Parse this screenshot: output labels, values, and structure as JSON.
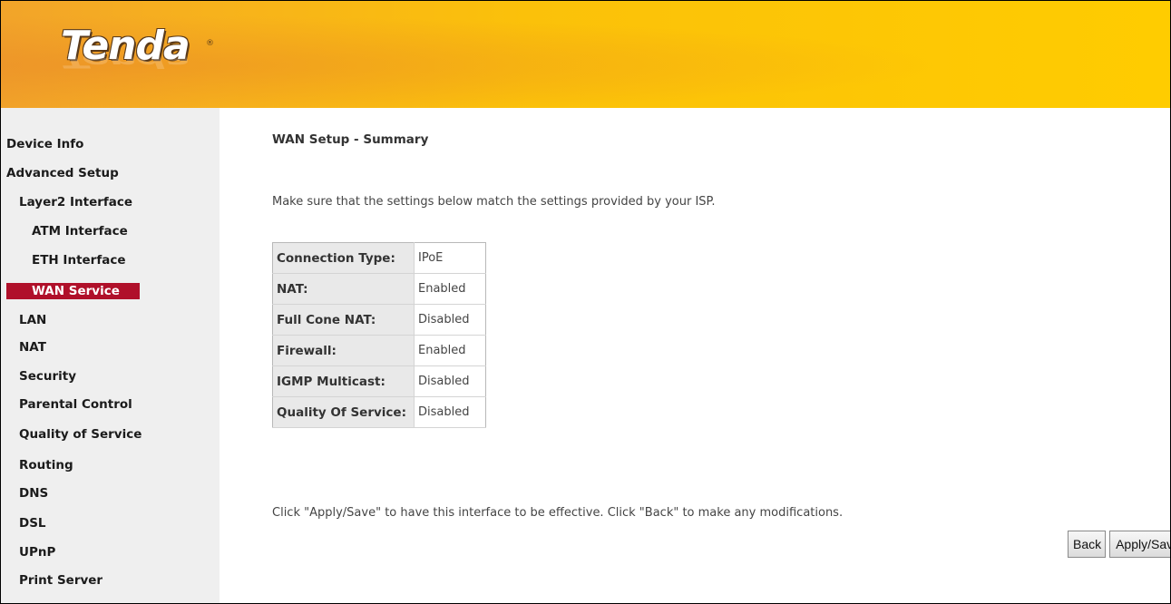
{
  "brand": {
    "logo_text": "Tenda",
    "registered_mark": "®"
  },
  "sidebar": {
    "items": [
      {
        "label": "Device Info",
        "level": 0
      },
      {
        "label": "Advanced Setup",
        "level": 0
      },
      {
        "label": "Layer2 Interface",
        "level": 1
      },
      {
        "label": "ATM Interface",
        "level": 2
      },
      {
        "label": "ETH Interface",
        "level": 2
      },
      {
        "label": "WAN Service",
        "level": 2,
        "active": true
      },
      {
        "label": "LAN",
        "level": 1
      },
      {
        "label": "NAT",
        "level": 1
      },
      {
        "label": "Security",
        "level": 1
      },
      {
        "label": "Parental Control",
        "level": 1
      },
      {
        "label": "Quality of Service",
        "level": 1
      },
      {
        "label": "Routing",
        "level": 1
      },
      {
        "label": "DNS",
        "level": 1
      },
      {
        "label": "DSL",
        "level": 1
      },
      {
        "label": "UPnP",
        "level": 1
      },
      {
        "label": "Print Server",
        "level": 1
      }
    ]
  },
  "main": {
    "title": "WAN Setup - Summary",
    "intro": "Make sure that the settings below match the settings provided by your ISP.",
    "summary_rows": [
      {
        "label": "Connection Type:",
        "value": "IPoE"
      },
      {
        "label": "NAT:",
        "value": "Enabled"
      },
      {
        "label": "Full Cone NAT:",
        "value": "Disabled"
      },
      {
        "label": "Firewall:",
        "value": "Enabled"
      },
      {
        "label": "IGMP Multicast:",
        "value": "Disabled"
      },
      {
        "label": "Quality Of Service:",
        "value": "Disabled"
      }
    ],
    "footer_note": "Click \"Apply/Save\" to have this interface to be effective. Click \"Back\" to make any modifications.",
    "buttons": {
      "back": "Back",
      "apply_save": "Apply/Save"
    }
  },
  "colors": {
    "header_orange": "#f2a42a",
    "header_yellow": "#ffcc00",
    "active_nav": "#b0102a",
    "sidebar_bg": "#efefef"
  }
}
